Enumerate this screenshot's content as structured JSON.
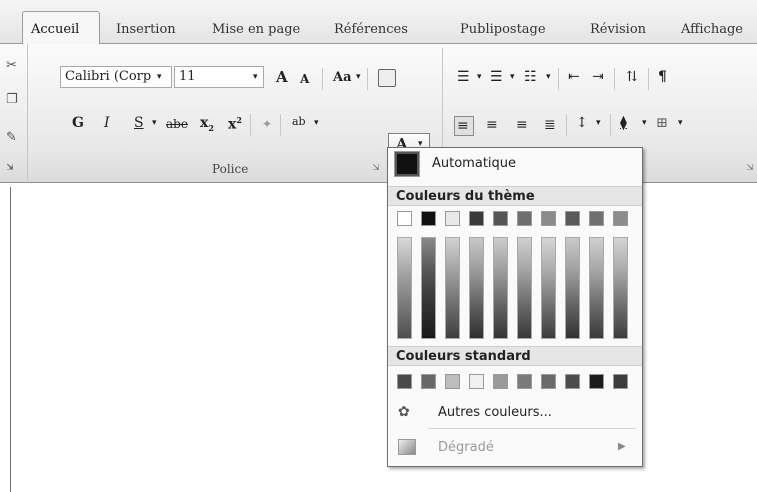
{
  "tabs": [
    {
      "label": "Accueil",
      "active": true
    },
    {
      "label": "Insertion"
    },
    {
      "label": "Mise en page"
    },
    {
      "label": "Références"
    },
    {
      "label": "Publipostage"
    },
    {
      "label": "Révision"
    },
    {
      "label": "Affichage"
    }
  ],
  "font": {
    "name": "Calibri (Corp",
    "size": "11",
    "grow_label": "A",
    "shrink_label": "A",
    "case_label": "Aa",
    "bold_label": "G",
    "italic_label": "I",
    "underline_label": "S",
    "strike_label": "abe",
    "subscript_label": "x",
    "superscript_label": "x",
    "highlight_label": "ab",
    "font_color_label": "A",
    "group_label": "Police"
  },
  "dropdown": {
    "automatic_label": "Automatique",
    "theme_header": "Couleurs du thème",
    "standard_header": "Couleurs standard",
    "more_colors_label": "Autres couleurs...",
    "gradient_label": "Dégradé",
    "theme_top_colors": [
      "#ffffff",
      "#111111",
      "#e8e8e8",
      "#3a3a3a",
      "#555555",
      "#6e6e6e",
      "#8a8a8a",
      "#5a5a5a",
      "#707070",
      "#8c8c8c"
    ],
    "theme_gradient_colors": [
      [
        "#d8d8d8",
        "#a6a6a6",
        "#7a7a7a",
        "#4e4e4e"
      ],
      [
        "#8a8a8a",
        "#555555",
        "#333333",
        "#1a1a1a"
      ],
      [
        "#d2d2d2",
        "#a0a0a0",
        "#6e6e6e",
        "#3e3e3e"
      ],
      [
        "#c8c8c8",
        "#9a9a9a",
        "#626262",
        "#2e2e2e"
      ],
      [
        "#cccccc",
        "#9c9c9c",
        "#666666",
        "#343434"
      ],
      [
        "#d0d0d0",
        "#a2a2a2",
        "#6a6a6a",
        "#383838"
      ],
      [
        "#d6d6d6",
        "#aaaaaa",
        "#727272",
        "#3c3c3c"
      ],
      [
        "#cacaca",
        "#9e9e9e",
        "#646464",
        "#323232"
      ],
      [
        "#d0d0d0",
        "#a4a4a4",
        "#6c6c6c",
        "#3a3a3a"
      ],
      [
        "#d4d4d4",
        "#a8a8a8",
        "#707070",
        "#3c3c3c"
      ]
    ],
    "standard_colors": [
      "#4a4a4a",
      "#686868",
      "#bdbdbd",
      "#f0f0f0",
      "#9a9a9a",
      "#7a7a7a",
      "#6a6a6a",
      "#4c4c4c",
      "#1c1c1c",
      "#3c3c3c"
    ]
  }
}
